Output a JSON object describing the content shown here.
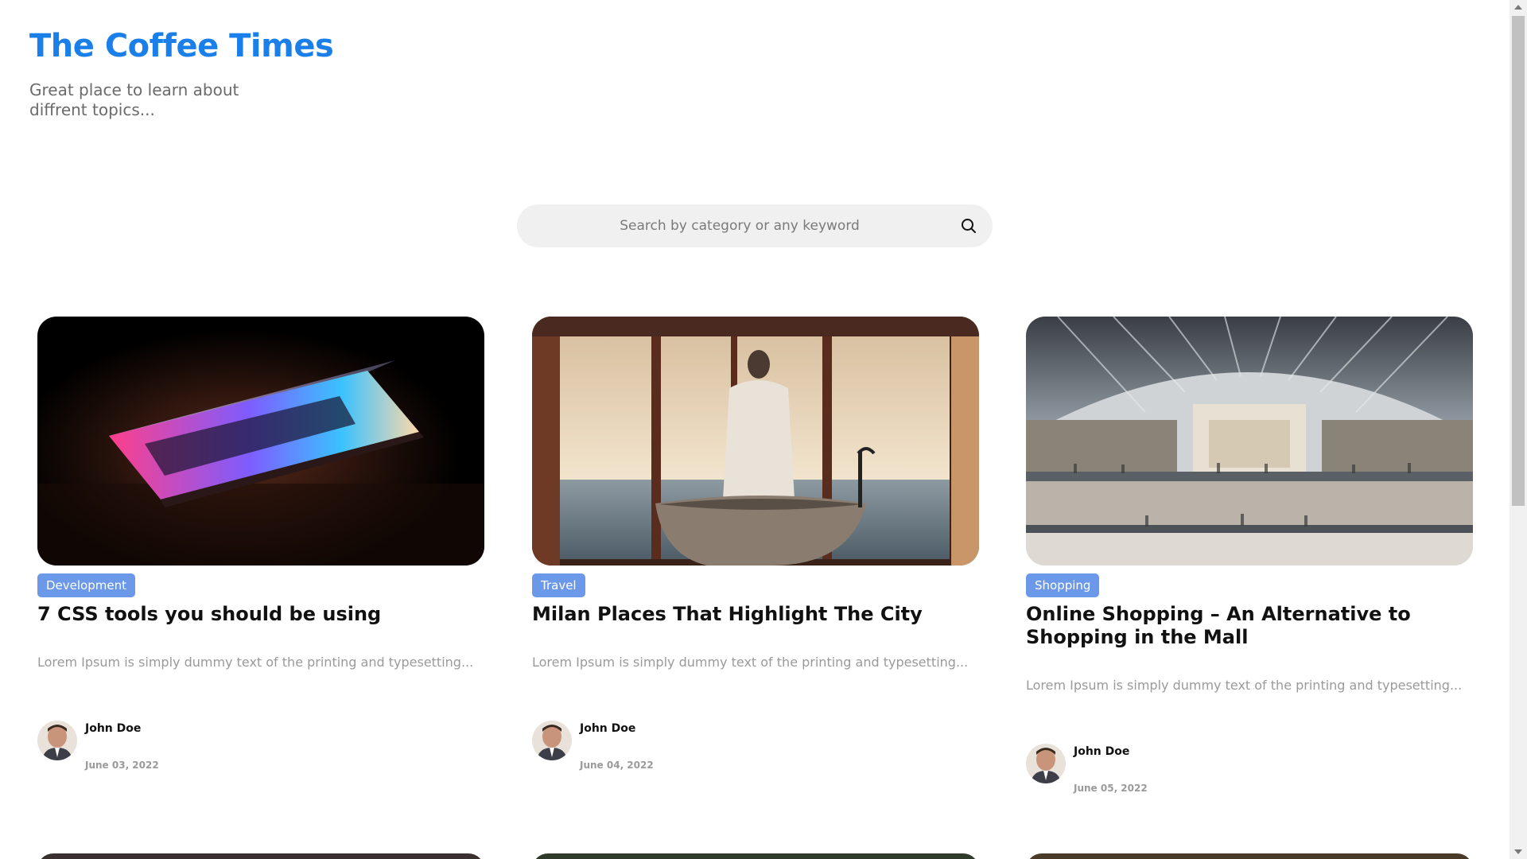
{
  "site": {
    "title": "The Coffee Times",
    "tagline": "Great place to learn about diffrent topics...",
    "brand_color": "#1a7fe8"
  },
  "search": {
    "placeholder": "Search by category or any keyword",
    "value": "",
    "icon": "search-icon"
  },
  "posts": [
    {
      "tag": "Development",
      "title": "7 CSS tools you should be using",
      "excerpt": "Lorem Ipsum is simply dummy text of the printing and typesetting...",
      "author": "John Doe",
      "date": "June 03, 2022",
      "image": "laptop-photo"
    },
    {
      "tag": "Travel",
      "title": "Milan Places That Highlight The City",
      "excerpt": "Lorem Ipsum is simply dummy text of the printing and typesetting...",
      "author": "John Doe",
      "date": "June 04, 2022",
      "image": "bathroom-window-photo"
    },
    {
      "tag": "Shopping",
      "title": "Online Shopping – An Alternative to Shopping in the Mall",
      "excerpt": "Lorem Ipsum is simply dummy text of the printing and typesetting...",
      "author": "John Doe",
      "date": "June 05, 2022",
      "image": "shopping-mall-photo"
    }
  ],
  "colors": {
    "tag_background": "#6b98e8",
    "search_background": "#f0f0f0"
  }
}
